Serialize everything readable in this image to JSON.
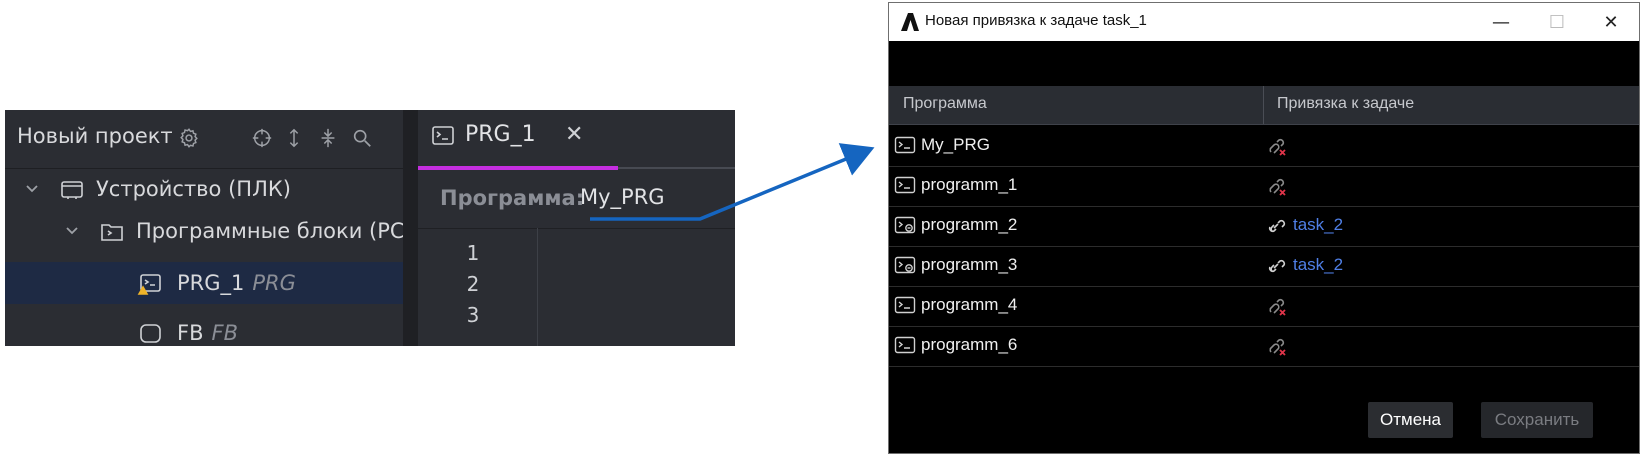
{
  "ide": {
    "project_title": "Новый проект",
    "tree": [
      {
        "label": "Устройство (ПЛК)"
      },
      {
        "label": "Программные блоки (PC"
      },
      {
        "label": "PRG_1",
        "kind": "PRG"
      },
      {
        "label": "FB",
        "kind": "FB"
      }
    ],
    "tab": {
      "label": "PRG_1",
      "close": "✕"
    },
    "program_label": "Программа:",
    "program_value": "My_PRG",
    "line_numbers": [
      "1",
      "2",
      "3"
    ]
  },
  "dialog": {
    "title": "Новая привязка к задаче task_1",
    "window_controls": {
      "minimize": "—",
      "maximize": "☐",
      "close": "✕"
    },
    "columns": [
      "Программа",
      "Привязка к задаче"
    ],
    "rows": [
      {
        "program": "My_PRG",
        "task": ""
      },
      {
        "program": "programm_1",
        "task": ""
      },
      {
        "program": "programm_2",
        "task": "task_2"
      },
      {
        "program": "programm_3",
        "task": "task_2"
      },
      {
        "program": "programm_4",
        "task": ""
      },
      {
        "program": "programm_6",
        "task": ""
      }
    ],
    "cancel_label": "Отмена",
    "save_label": "Сохранить"
  },
  "colors": {
    "ide_bg": "#2b2d33",
    "tab_accent": "#c52ee0",
    "selection": "#1e2a44",
    "callout": "#1565c0",
    "task_link": "#4f7fe6",
    "unlinked_x": "#e0344a"
  }
}
